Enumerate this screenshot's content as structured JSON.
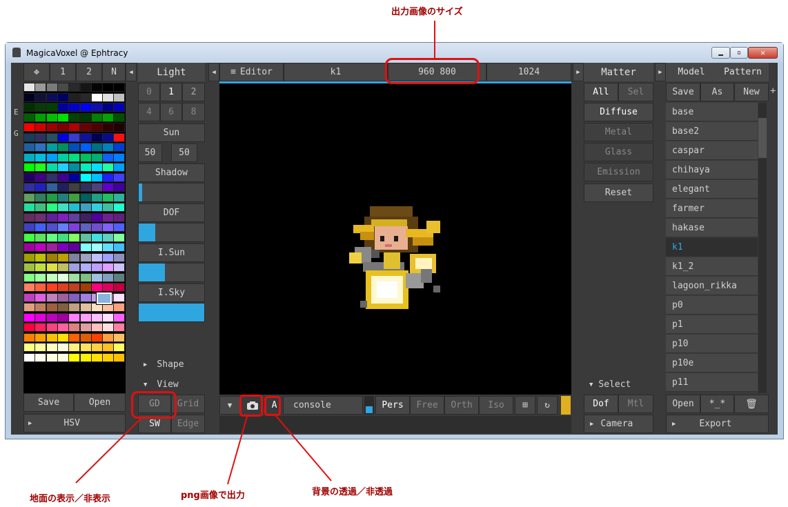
{
  "annotations": {
    "size": "出力画像のサイズ",
    "ground": "地面の表示／非表示",
    "png": "png画像で出力",
    "bg": "背景の透過／非透過"
  },
  "window": {
    "title": "MagicaVoxel @ Ephtracy"
  },
  "palette": {
    "tabs": [
      "1",
      "2",
      "N"
    ],
    "side": [
      "E",
      "G"
    ],
    "save": "Save",
    "open": "Open",
    "mode": "HSV",
    "colors": [
      [
        "#e6e6e6",
        "#9a9a9a",
        "#7a7a7a",
        "#4a4a4a",
        "#2a2a2a",
        "#161616",
        "#050505",
        "#000000",
        "#000000"
      ],
      [
        "#000022",
        "#101038",
        "#0c0c5c",
        "#000062",
        "#202020",
        "#282828",
        "#ffffff",
        "#e0e0e0",
        "#c0c0c0"
      ],
      [
        "#003000",
        "#0a3a0a",
        "#004000",
        "#0000a0",
        "#0000d0",
        "#0000ff",
        "#1010b0",
        "#00008a",
        "#0000c0"
      ],
      [
        "#006000",
        "#00a000",
        "#00c000",
        "#00e000",
        "#004400",
        "#003800",
        "#008000",
        "#00a400",
        "#005000"
      ],
      [
        "#ff0000",
        "#d00000",
        "#a00000",
        "#800000",
        "#b00000",
        "#6a0000",
        "#500000",
        "#300000",
        "#200000"
      ],
      [
        "#1a3b5a",
        "#303060",
        "#2a4f60",
        "#0000e0",
        "#3a3ad8",
        "#1010a0",
        "#000050",
        "#0a0a90",
        "#ff1010"
      ],
      [
        "#2060a0",
        "#3070c0",
        "#00a0a0",
        "#009060",
        "#0050c0",
        "#0060ff",
        "#007080",
        "#0080c0",
        "#0040d0"
      ],
      [
        "#00b0c0",
        "#00c0e0",
        "#00a0ff",
        "#00d0a0",
        "#00e080",
        "#00c060",
        "#00b070",
        "#1060ff",
        "#0080ff"
      ],
      [
        "#00ff00",
        "#20ff20",
        "#00e0a0",
        "#20d0ff",
        "#0090a0",
        "#00f0c0",
        "#00e0ff",
        "#20ffa0",
        "#00a0ff"
      ],
      [
        "#200060",
        "#40008a",
        "#30306a",
        "#400090",
        "#0000a0",
        "#00ffff",
        "#00c0ff",
        "#2020ff",
        "#4040ff"
      ],
      [
        "#3030a0",
        "#2020c0",
        "#3060a0",
        "#202060",
        "#404040",
        "#303060",
        "#504080",
        "#6000d0",
        "#4000a0"
      ],
      [
        "#60a060",
        "#308060",
        "#20a040",
        "#208080",
        "#40a040",
        "#006060",
        "#20a080",
        "#20c060",
        "#30b0a0"
      ],
      [
        "#20e0a0",
        "#40c080",
        "#20ff80",
        "#40e0c0",
        "#20c0d0",
        "#40a0c0",
        "#30d0e0",
        "#40c0a0",
        "#20ffd0"
      ],
      [
        "#603060",
        "#703070",
        "#6020a0",
        "#8020c0",
        "#6040a0",
        "#402060",
        "#5000a0",
        "#702090",
        "#602080"
      ],
      [
        "#4040c0",
        "#4060ff",
        "#5050d0",
        "#6080ff",
        "#8040e0",
        "#6060c0",
        "#7050d0",
        "#8060ff",
        "#5060ff"
      ],
      [
        "#40ff40",
        "#60e060",
        "#60ff80",
        "#40e080",
        "#80ff60",
        "#60c0a0",
        "#40e0e0",
        "#60d0c0",
        "#80ffa0"
      ],
      [
        "#a000a0",
        "#c000c0",
        "#a020a0",
        "#8000c0",
        "#6000a0",
        "#80ffff",
        "#a0ffff",
        "#60e0ff",
        "#40c0ff"
      ],
      [
        "#a0a000",
        "#c0c000",
        "#a08000",
        "#c0a000",
        "#8080a0",
        "#a0a0c0",
        "#c0c0ff",
        "#a0a0ff",
        "#9090c0"
      ],
      [
        "#a0c040",
        "#c0e040",
        "#e0e040",
        "#c0c060",
        "#a0a0e0",
        "#b0b0ff",
        "#c0a0ff",
        "#e0a0ff",
        "#d0c0ff"
      ],
      [
        "#80ff80",
        "#a0ffa0",
        "#c0ffc0",
        "#e0ffe0",
        "#a0e0a0",
        "#80c080",
        "#a0c0e0",
        "#80a0c0",
        "#608080"
      ],
      [
        "#ff8060",
        "#ff6040",
        "#ff4020",
        "#e04020",
        "#c04020",
        "#a04000",
        "#ff0080",
        "#e00060",
        "#c00040"
      ],
      [
        "#c040c0",
        "#e060e0",
        "#c080c0",
        "#a060a0",
        "#8060c0",
        "#a080e0",
        "#c0a0e0",
        "#e0c0ff",
        "#ffe0ff"
      ],
      [
        "#e0a080",
        "#c08060",
        "#a06040",
        "#806040",
        "#c0a080",
        "#e0c0a0",
        "#ffe0c0",
        "#ffc0a0",
        "#ffa080"
      ],
      [
        "#ff00ff",
        "#e000e0",
        "#c000c0",
        "#a000a0",
        "#ff80ff",
        "#ffa0ff",
        "#ffc0ff",
        "#ffe0ff",
        "#ff60ff"
      ],
      [
        "#ff0040",
        "#ff2060",
        "#ff4080",
        "#ff60a0",
        "#e08080",
        "#e0a0a0",
        "#ffc0c0",
        "#ffe0e0",
        "#ff80a0"
      ],
      [
        "#ff8000",
        "#ffa000",
        "#ffc000",
        "#ffe000",
        "#ff6000",
        "#e06000",
        "#ff4000",
        "#ffa040",
        "#ffc060"
      ],
      [
        "#ffff80",
        "#ffffa0",
        "#ffffc0",
        "#ffffe0",
        "#fff080",
        "#ffe060",
        "#ffd040",
        "#ffc020",
        "#ffff60"
      ],
      [
        "#ffffff",
        "#fffff0",
        "#fffee0",
        "#fffde0",
        "#ffff00",
        "#fff000",
        "#ffe000",
        "#ffd000",
        "#ffc000"
      ]
    ]
  },
  "light": {
    "title": "Light",
    "nums": [
      "0",
      "1",
      "2",
      "4",
      "6",
      "8"
    ],
    "sun": "Sun",
    "sun_vals": [
      "50",
      "50"
    ],
    "shadow": "Shadow",
    "dof": "DOF",
    "isun": "I.Sun",
    "isky": "I.Sky",
    "shape": "Shape",
    "view": "View",
    "gd": "GD",
    "grid": "Grid",
    "sw": "SW",
    "edge": "Edge",
    "shadow_level": 0.05,
    "dof_level": 0.25,
    "isun_level": 0.4,
    "isky_level": 1.0
  },
  "viewport": {
    "editor": "Editor",
    "name": "k1",
    "size": "960 800",
    "res": "1024",
    "console": "console",
    "modes": [
      "Pers",
      "Free",
      "Orth",
      "Iso"
    ],
    "a": "A"
  },
  "matter": {
    "title": "Matter",
    "all": "All",
    "sel": "Sel",
    "items": [
      "Diffuse",
      "Metal",
      "Glass",
      "Emission"
    ],
    "reset": "Reset",
    "select": "Select",
    "dof": "Dof",
    "mtl": "Mtl",
    "camera": "Camera"
  },
  "model": {
    "tabs": [
      "Model",
      "Pattern"
    ],
    "save": "Save",
    "as": "As",
    "new": "New",
    "plus": "+",
    "items": [
      "base",
      "base2",
      "caspar",
      "chihaya",
      "elegant",
      "farmer",
      "hakase",
      "k1",
      "k1_2",
      "lagoon_rikka",
      "p0",
      "p1",
      "p10",
      "p10e",
      "p11"
    ],
    "selected": "k1",
    "open": "Open",
    "star": "*_*",
    "export": "Export"
  }
}
